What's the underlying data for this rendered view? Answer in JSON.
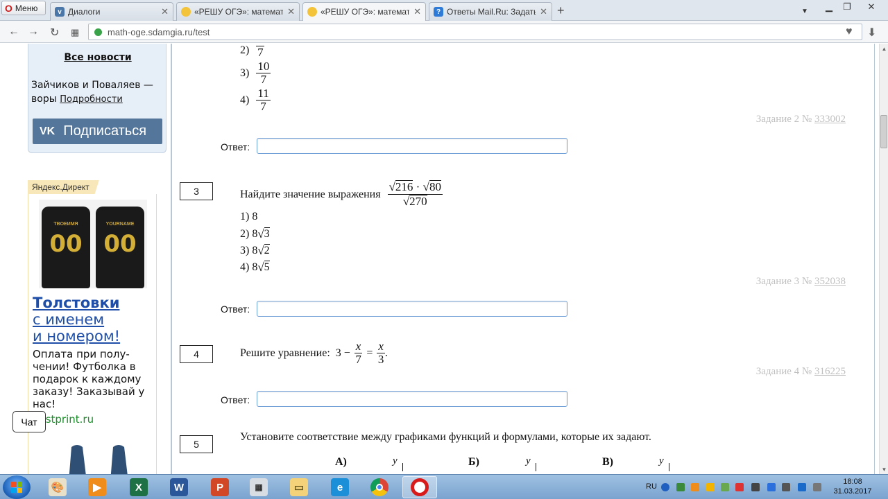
{
  "browser": {
    "menu_label": "Меню",
    "tabs": [
      {
        "label": "Диалоги",
        "icon": "vk-icon",
        "active": false
      },
      {
        "label": "«РЕШУ ОГЭ»: математика",
        "icon": "sun-icon",
        "active": false
      },
      {
        "label": "«РЕШУ ОГЭ»: математика",
        "icon": "sun-icon",
        "active": true
      },
      {
        "label": "Ответы Mail.Ru: Задать во",
        "icon": "help-icon",
        "active": false
      }
    ],
    "url": "math-oge.sdamgia.ru/test"
  },
  "sidebar": {
    "all_news": "Все новости",
    "news_text": "Зайчиков и Поваляев — воры",
    "news_more": "Подробности",
    "vk_logo": "VK",
    "vk_subscribe": "Подписаться",
    "ad_label": "Яндекс.Директ",
    "ad_shirt_left": {
      "name": "ТВОЕИМЯ",
      "number": "00"
    },
    "ad_shirt_right": {
      "name": "YOURNAME",
      "number": "00"
    },
    "ad_title_1": "Толстовки",
    "ad_title_2": "с именем",
    "ad_title_3": "и номером!",
    "ad_body": "Оплата при полу-чении! Футболка в подарок к каждому заказу! Заказывай у нас!",
    "ad_domain": "gostprint.ru",
    "chat": "Чат"
  },
  "tasks": {
    "t2": {
      "options": [
        {
          "prefix": "2)",
          "num": "",
          "den": "7"
        },
        {
          "prefix": "3)",
          "num": "10",
          "den": "7"
        },
        {
          "prefix": "4)",
          "num": "11",
          "den": "7"
        }
      ],
      "ref_prefix": "Задание 2 №",
      "ref_id": "333002"
    },
    "answer_label": "Ответ:",
    "t3": {
      "number": "3",
      "text": "Найдите значение выражения",
      "expr_num_a": "216",
      "expr_dot": "·",
      "expr_num_b": "80",
      "expr_den": "270",
      "options": [
        {
          "prefix": "1)",
          "value": "8",
          "root": ""
        },
        {
          "prefix": "2)",
          "value": "8",
          "root": "3"
        },
        {
          "prefix": "3)",
          "value": "8",
          "root": "2"
        },
        {
          "prefix": "4)",
          "value": "8",
          "root": "5"
        }
      ],
      "ref_prefix": "Задание 3 №",
      "ref_id": "352038"
    },
    "t4": {
      "number": "4",
      "text": "Решите уравнение:",
      "lhs": "3 −",
      "frac1_num": "x",
      "frac1_den": "7",
      "eq": "=",
      "frac2_num": "x",
      "frac2_den": "3",
      "end": ".",
      "ref_prefix": "Задание 4 №",
      "ref_id": "316225"
    },
    "t5": {
      "number": "5",
      "text": "Установите соответствие между графиками функций и формулами, которые их задают.",
      "graphs": [
        {
          "label": "А)",
          "axis": "y"
        },
        {
          "label": "Б)",
          "axis": "y"
        },
        {
          "label": "В)",
          "axis": "y"
        }
      ]
    }
  },
  "taskbar": {
    "apps": [
      "paint-icon",
      "media-player-icon",
      "excel-icon",
      "word-icon",
      "powerpoint-icon",
      "calculator-icon",
      "explorer-icon",
      "ie-icon",
      "chrome-icon",
      "opera-icon"
    ],
    "lang": "RU",
    "time": "18:08",
    "date": "31.03.2017"
  },
  "colors": {
    "link_blue": "#1f4ea8",
    "vk_blue": "#54769b",
    "ref_gray": "#c0c0c0",
    "input_border": "#6f9fd6"
  }
}
